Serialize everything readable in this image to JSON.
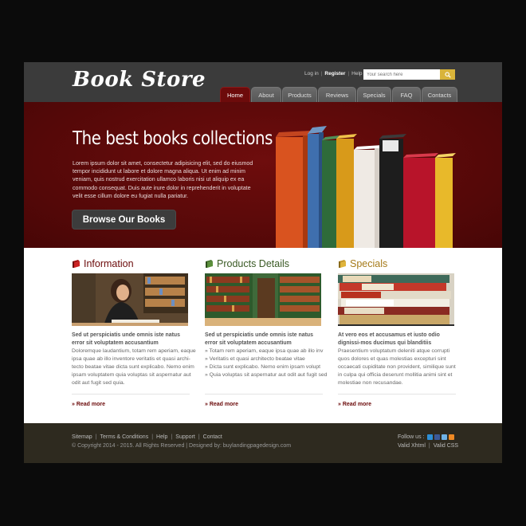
{
  "header": {
    "logo": "Book Store",
    "login": "Log in",
    "register": "Register",
    "help": "Help",
    "search_placeholder": "Your search here",
    "nav": [
      "Home",
      "About",
      "Products",
      "Reviews",
      "Specials",
      "FAQ",
      "Contacts"
    ]
  },
  "hero": {
    "title": "The best books collections",
    "text": "Lorem ipsum dolor sit amet, consectetur adipisicing elit, sed do eiusmod tempor incididunt ut labore et dolore magna aliqua. Ut enim ad minim veniam, quis nostrud exercitation ullamco laboris nisi ut aliquip ex ea commodo consequat. Duis aute irure dolor in reprehenderit in voluptate velit esse cillum dolore eu fugiat nulla pariatur.",
    "button": "Browse Our Books"
  },
  "columns": [
    {
      "title": "Information",
      "subtitle": "Sed ut perspiciatis unde omnis iste natus error sit voluptatem accusantium",
      "lines": [
        "Doloremque laudantium, totam rem aperiam, eaque",
        "ipsa quae ab illo inventore veritatis et quasi archi-",
        "tecto beatae vitae dicta sunt explicabo. Nemo enim",
        "ipsam voluptatem quia voluptas sit aspernatur aut",
        "odit aut fugit sed quia."
      ],
      "read_more": "» Read more"
    },
    {
      "title": "Products Details",
      "subtitle": "Sed ut perspiciatis unde omnis iste natus error sit voluptatem accusantium",
      "lines": [
        "» Totam rem aperiam, eaque ipsa quae ab illo inv",
        "» Veritatis et quasi architecto beatae vitae",
        "» Dicta sunt explicabo. Nemo enim ipsam volupt",
        "» Quia voluptas sit aspernatur aut odit aut fugit sed"
      ],
      "read_more": "» Read more"
    },
    {
      "title": "Specials",
      "subtitle": "At vero eos et accusamus et iusto odio dignissi-mos ducimus qui blanditiis",
      "lines": [
        "Praesentium voluptatum deleniti atque corrupti",
        "quos dolores et quas molestias excepturi sint",
        "occaecati cupiditate non provident, similique sunt",
        "in culpa qui officia deserunt mollitia animi sint et",
        "molestiae non recusandae."
      ],
      "read_more": "» Read more"
    }
  ],
  "footer": {
    "links": [
      "Sitemap",
      "Terms & Conditions",
      "Help",
      "Support",
      "Contact"
    ],
    "copyright": "© Copyright 2014 - 2015. All Rights Reserved | Designed by: buylandingpagedesign.com",
    "follow": "Follow us :",
    "valid_xhtml": "Valid Xhtml",
    "valid_css": "Valid CSS"
  },
  "colors": {
    "header_bg": "#3b3b3b",
    "hero_bg": "#5e0a0a",
    "accent_red": "#6b0a0a",
    "accent_green": "#3a5a24",
    "accent_gold": "#a67b1a",
    "footer_bg": "#2e2a1f"
  },
  "icons": [
    "search-icon",
    "book-icon",
    "twitter-icon",
    "facebook-icon",
    "delicious-icon",
    "rss-icon"
  ]
}
